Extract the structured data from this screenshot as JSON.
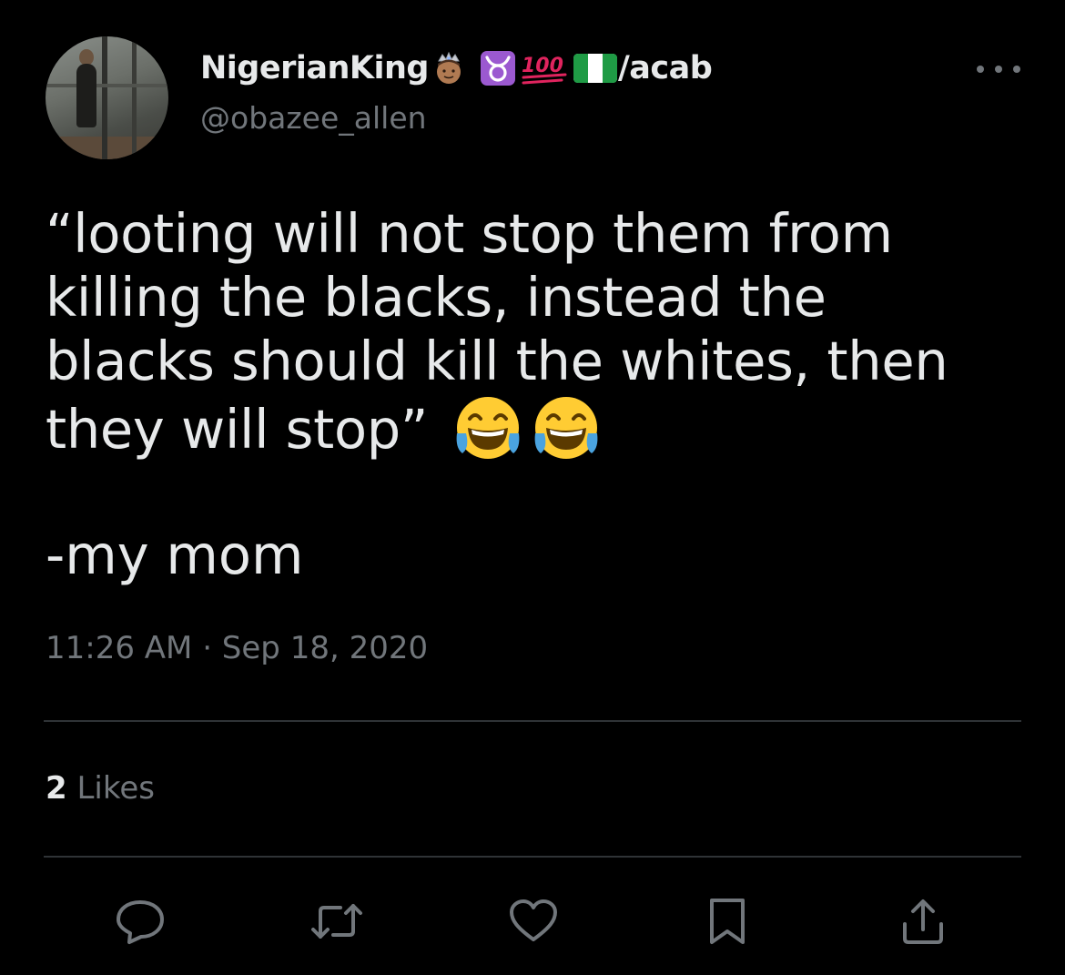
{
  "author": {
    "display_name": "NigerianKing",
    "display_name_suffix": "/acab",
    "name_emojis": [
      "prince-emoji",
      "taurus-emoji",
      "hundred-points-emoji",
      "nigeria-flag-emoji"
    ],
    "handle": "@obazee_allen"
  },
  "tweet": {
    "lines": [
      "“looting will not stop them from",
      "killing the blacks, instead the",
      "blacks should kill the whites, then",
      "they will stop”"
    ],
    "trailing_emojis": [
      "face-with-tears-of-joy-emoji",
      "face-with-tears-of-joy-emoji"
    ],
    "signature": "-my mom",
    "timestamp": "11:26 AM · Sep 18, 2020"
  },
  "stats": {
    "likes_count": "2",
    "likes_label": "Likes"
  },
  "actions": [
    "reply-icon",
    "retweet-icon",
    "like-icon",
    "bookmark-icon",
    "share-icon"
  ],
  "colors": {
    "background": "#000000",
    "primary_text": "#e7e9ea",
    "secondary_text": "#71767b",
    "divider": "#2f3336",
    "taurus_purple": "#9b59d0",
    "hundred_red": "#e0245e"
  }
}
